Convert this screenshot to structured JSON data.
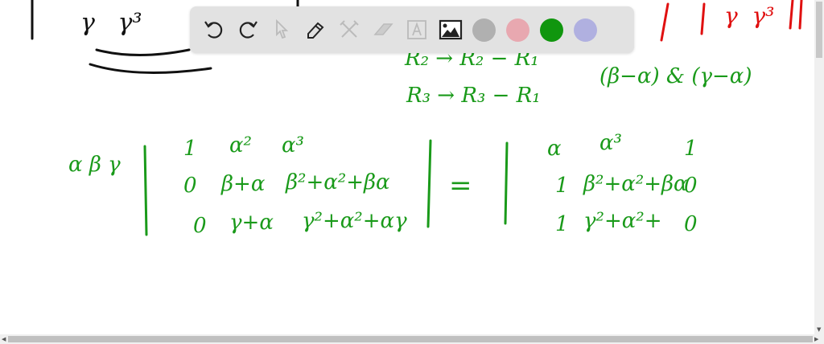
{
  "toolbar": {
    "tools": [
      "undo-icon",
      "redo-icon",
      "select-icon",
      "pen-icon",
      "tools-icon",
      "eraser-icon",
      "text-icon",
      "image-icon"
    ],
    "colors": [
      "#b0b0b0",
      "#e8a8b0",
      "#10960e",
      "#b0b0e0"
    ]
  },
  "ink_colors": {
    "green": "#1a9a1a",
    "black": "#111111",
    "red": "#e01010"
  },
  "board": {
    "top_left": "γ   γ³",
    "top_right": "γ  γ³",
    "op1": "R₂ → R₂ − R₁",
    "op2": "R₃ → R₃ − R₁",
    "factors": "(β−α) & (γ−α)",
    "prefactor": "α β γ",
    "m1": [
      [
        "1",
        "α²",
        "α³"
      ],
      [
        "0",
        "β+α",
        "β²+α²+βα"
      ],
      [
        "0",
        "γ+α",
        "γ²+α²+αγ"
      ]
    ],
    "equals": "=",
    "m2": [
      [
        "α",
        "α³",
        "1"
      ],
      [
        "1",
        "β²+α²+βα",
        "0"
      ],
      [
        "1",
        "γ²+α²+",
        "0"
      ]
    ]
  }
}
